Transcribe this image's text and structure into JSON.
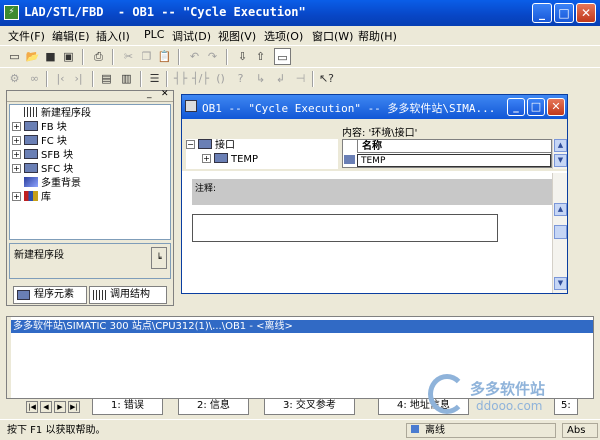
{
  "window": {
    "title": "LAD/STL/FBD  - OB1 -- \"Cycle Execution\"",
    "minimize": "_",
    "maximize": "□",
    "close": "✕"
  },
  "menu": [
    "文件(F)",
    "编辑(E)",
    "插入(I)",
    "PLC",
    "调试(D)",
    "视图(V)",
    "选项(O)",
    "窗口(W)",
    "帮助(H)"
  ],
  "left_panel": {
    "tree": [
      {
        "label": "新建程序段",
        "icon": "network-icon",
        "expandable": false
      },
      {
        "label": "FB 块",
        "icon": "fb-block-icon",
        "expandable": true
      },
      {
        "label": "FC 块",
        "icon": "fc-block-icon",
        "expandable": true
      },
      {
        "label": "SFB 块",
        "icon": "sfb-block-icon",
        "expandable": true
      },
      {
        "label": "SFC 块",
        "icon": "sfc-block-icon",
        "expandable": true
      },
      {
        "label": "多重背景",
        "icon": "multi-instance-icon",
        "expandable": false
      },
      {
        "label": "库",
        "icon": "library-icon",
        "expandable": true
      }
    ],
    "description": "新建程序段",
    "tabs": [
      "程序元素",
      "调用结构"
    ]
  },
  "editor": {
    "title": "OB1 -- \"Cycle Execution\" -- 多多软件站\\SIMA...",
    "content_label": "内容:  '环境\\接口'",
    "decl_tree": [
      {
        "label": "接口",
        "expandable": true
      },
      {
        "label": "TEMP",
        "expandable": true
      }
    ],
    "grid_header": "名称",
    "grid_row": "TEMP",
    "network_comment": "注释:"
  },
  "output": {
    "line": "多多软件站\\SIMATIC 300 站点\\CPU312(1)\\...\\OB1 - <离线>",
    "tabs": [
      "1: 错误",
      "2: 信息",
      "3: 交叉参考",
      "4: 地址信息",
      "5:"
    ]
  },
  "status": {
    "hint": "按下 F1 以获取帮助。",
    "mode": "离线",
    "abs": "Abs"
  },
  "watermark": {
    "name": "多多软件站",
    "url": "ddooo.com"
  }
}
